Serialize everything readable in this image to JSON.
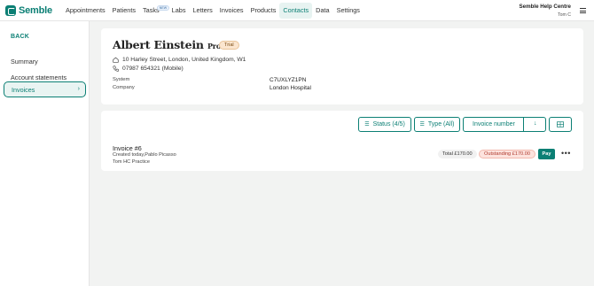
{
  "app": {
    "name": "Semble"
  },
  "nav": {
    "items": [
      {
        "label": "Appointments"
      },
      {
        "label": "Patients"
      },
      {
        "label": "Tasks",
        "badge": "NEW"
      },
      {
        "label": "Labs"
      },
      {
        "label": "Letters"
      },
      {
        "label": "Invoices"
      },
      {
        "label": "Products"
      },
      {
        "label": "Contacts",
        "active": true
      },
      {
        "label": "Data"
      },
      {
        "label": "Settings"
      }
    ]
  },
  "help": {
    "title": "Semble Help Centre",
    "user": "Tom C"
  },
  "sidebar": {
    "back": "BACK",
    "items": [
      {
        "label": "Summary"
      },
      {
        "label": "Account statements"
      },
      {
        "label": "Invoices",
        "active": true
      }
    ]
  },
  "patient": {
    "name": "Albert Einstein",
    "title": "Prof",
    "badge": "Trial",
    "address": "10 Harley Street, London, United Kingdom, W1",
    "phone": "07987 654321 (Mobile)",
    "system_label": "System",
    "system_value": "C7UXLYZ1PN",
    "company_label": "Company",
    "company_value": "London Hospital"
  },
  "filters": {
    "status": "Status (4/5)",
    "type": "Type (All)",
    "sort": "Invoice number"
  },
  "invoice": {
    "title": "Invoice #6",
    "created": "Created today,Pablo Picasso",
    "practice": "Tom HC Practice",
    "total": "Total £170.00",
    "outstanding": "Outstanding £170.00",
    "pay": "Pay"
  },
  "colors": {
    "accent": "#0b7f74",
    "outstanding": "#b03a2e"
  }
}
